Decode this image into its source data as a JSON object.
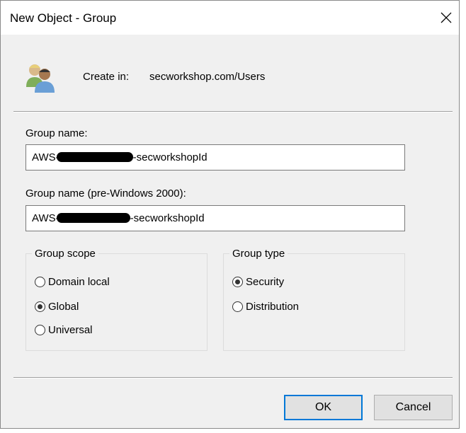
{
  "window": {
    "title": "New Object - Group"
  },
  "header": {
    "create_in_label": "Create in:",
    "create_in_value": "secworkshop.com/Users",
    "icon": "group-users-icon"
  },
  "fields": {
    "group_name": {
      "label": "Group name:",
      "value_prefix": "AWS-",
      "value_suffix": "-secworkshopId"
    },
    "group_name_pre2000": {
      "label": "Group name (pre-Windows 2000):",
      "value_prefix": "AWS-",
      "value_suffix": "-secworkshopId"
    }
  },
  "group_scope": {
    "legend": "Group scope",
    "options": [
      {
        "label": "Domain local",
        "checked": false
      },
      {
        "label": "Global",
        "checked": true
      },
      {
        "label": "Universal",
        "checked": false
      }
    ]
  },
  "group_type": {
    "legend": "Group type",
    "options": [
      {
        "label": "Security",
        "checked": true
      },
      {
        "label": "Distribution",
        "checked": false
      }
    ]
  },
  "buttons": {
    "ok": "OK",
    "cancel": "Cancel"
  }
}
